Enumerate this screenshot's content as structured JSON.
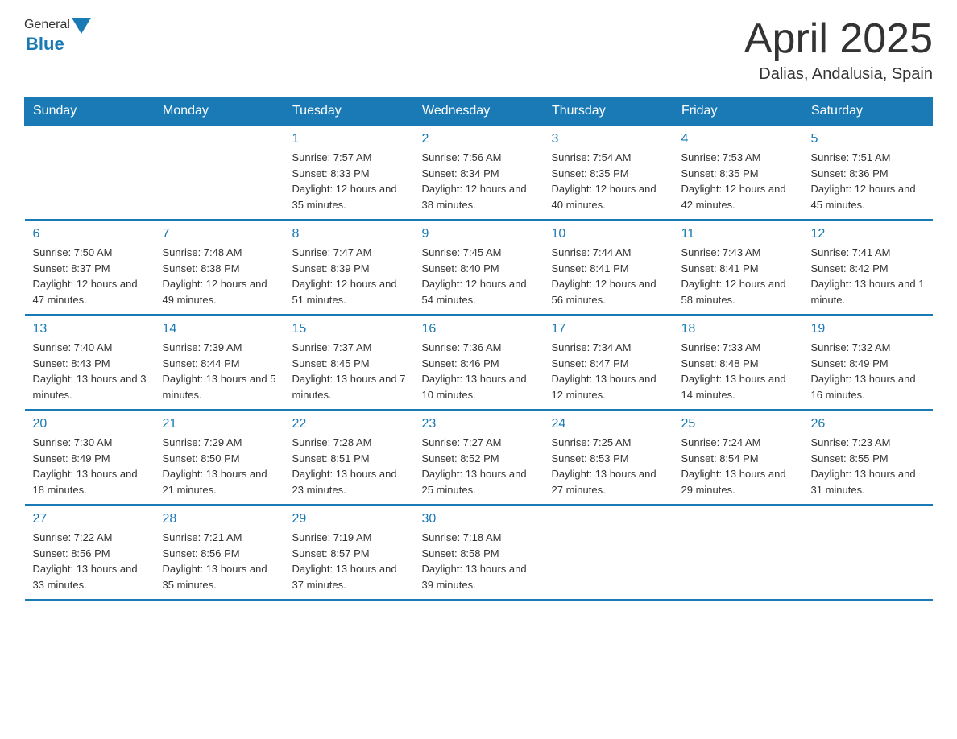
{
  "header": {
    "logo_general": "General",
    "logo_blue": "Blue",
    "month_title": "April 2025",
    "location": "Dalias, Andalusia, Spain"
  },
  "weekdays": [
    "Sunday",
    "Monday",
    "Tuesday",
    "Wednesday",
    "Thursday",
    "Friday",
    "Saturday"
  ],
  "weeks": [
    [
      {
        "day": "",
        "sunrise": "",
        "sunset": "",
        "daylight": ""
      },
      {
        "day": "",
        "sunrise": "",
        "sunset": "",
        "daylight": ""
      },
      {
        "day": "1",
        "sunrise": "Sunrise: 7:57 AM",
        "sunset": "Sunset: 8:33 PM",
        "daylight": "Daylight: 12 hours and 35 minutes."
      },
      {
        "day": "2",
        "sunrise": "Sunrise: 7:56 AM",
        "sunset": "Sunset: 8:34 PM",
        "daylight": "Daylight: 12 hours and 38 minutes."
      },
      {
        "day": "3",
        "sunrise": "Sunrise: 7:54 AM",
        "sunset": "Sunset: 8:35 PM",
        "daylight": "Daylight: 12 hours and 40 minutes."
      },
      {
        "day": "4",
        "sunrise": "Sunrise: 7:53 AM",
        "sunset": "Sunset: 8:35 PM",
        "daylight": "Daylight: 12 hours and 42 minutes."
      },
      {
        "day": "5",
        "sunrise": "Sunrise: 7:51 AM",
        "sunset": "Sunset: 8:36 PM",
        "daylight": "Daylight: 12 hours and 45 minutes."
      }
    ],
    [
      {
        "day": "6",
        "sunrise": "Sunrise: 7:50 AM",
        "sunset": "Sunset: 8:37 PM",
        "daylight": "Daylight: 12 hours and 47 minutes."
      },
      {
        "day": "7",
        "sunrise": "Sunrise: 7:48 AM",
        "sunset": "Sunset: 8:38 PM",
        "daylight": "Daylight: 12 hours and 49 minutes."
      },
      {
        "day": "8",
        "sunrise": "Sunrise: 7:47 AM",
        "sunset": "Sunset: 8:39 PM",
        "daylight": "Daylight: 12 hours and 51 minutes."
      },
      {
        "day": "9",
        "sunrise": "Sunrise: 7:45 AM",
        "sunset": "Sunset: 8:40 PM",
        "daylight": "Daylight: 12 hours and 54 minutes."
      },
      {
        "day": "10",
        "sunrise": "Sunrise: 7:44 AM",
        "sunset": "Sunset: 8:41 PM",
        "daylight": "Daylight: 12 hours and 56 minutes."
      },
      {
        "day": "11",
        "sunrise": "Sunrise: 7:43 AM",
        "sunset": "Sunset: 8:41 PM",
        "daylight": "Daylight: 12 hours and 58 minutes."
      },
      {
        "day": "12",
        "sunrise": "Sunrise: 7:41 AM",
        "sunset": "Sunset: 8:42 PM",
        "daylight": "Daylight: 13 hours and 1 minute."
      }
    ],
    [
      {
        "day": "13",
        "sunrise": "Sunrise: 7:40 AM",
        "sunset": "Sunset: 8:43 PM",
        "daylight": "Daylight: 13 hours and 3 minutes."
      },
      {
        "day": "14",
        "sunrise": "Sunrise: 7:39 AM",
        "sunset": "Sunset: 8:44 PM",
        "daylight": "Daylight: 13 hours and 5 minutes."
      },
      {
        "day": "15",
        "sunrise": "Sunrise: 7:37 AM",
        "sunset": "Sunset: 8:45 PM",
        "daylight": "Daylight: 13 hours and 7 minutes."
      },
      {
        "day": "16",
        "sunrise": "Sunrise: 7:36 AM",
        "sunset": "Sunset: 8:46 PM",
        "daylight": "Daylight: 13 hours and 10 minutes."
      },
      {
        "day": "17",
        "sunrise": "Sunrise: 7:34 AM",
        "sunset": "Sunset: 8:47 PM",
        "daylight": "Daylight: 13 hours and 12 minutes."
      },
      {
        "day": "18",
        "sunrise": "Sunrise: 7:33 AM",
        "sunset": "Sunset: 8:48 PM",
        "daylight": "Daylight: 13 hours and 14 minutes."
      },
      {
        "day": "19",
        "sunrise": "Sunrise: 7:32 AM",
        "sunset": "Sunset: 8:49 PM",
        "daylight": "Daylight: 13 hours and 16 minutes."
      }
    ],
    [
      {
        "day": "20",
        "sunrise": "Sunrise: 7:30 AM",
        "sunset": "Sunset: 8:49 PM",
        "daylight": "Daylight: 13 hours and 18 minutes."
      },
      {
        "day": "21",
        "sunrise": "Sunrise: 7:29 AM",
        "sunset": "Sunset: 8:50 PM",
        "daylight": "Daylight: 13 hours and 21 minutes."
      },
      {
        "day": "22",
        "sunrise": "Sunrise: 7:28 AM",
        "sunset": "Sunset: 8:51 PM",
        "daylight": "Daylight: 13 hours and 23 minutes."
      },
      {
        "day": "23",
        "sunrise": "Sunrise: 7:27 AM",
        "sunset": "Sunset: 8:52 PM",
        "daylight": "Daylight: 13 hours and 25 minutes."
      },
      {
        "day": "24",
        "sunrise": "Sunrise: 7:25 AM",
        "sunset": "Sunset: 8:53 PM",
        "daylight": "Daylight: 13 hours and 27 minutes."
      },
      {
        "day": "25",
        "sunrise": "Sunrise: 7:24 AM",
        "sunset": "Sunset: 8:54 PM",
        "daylight": "Daylight: 13 hours and 29 minutes."
      },
      {
        "day": "26",
        "sunrise": "Sunrise: 7:23 AM",
        "sunset": "Sunset: 8:55 PM",
        "daylight": "Daylight: 13 hours and 31 minutes."
      }
    ],
    [
      {
        "day": "27",
        "sunrise": "Sunrise: 7:22 AM",
        "sunset": "Sunset: 8:56 PM",
        "daylight": "Daylight: 13 hours and 33 minutes."
      },
      {
        "day": "28",
        "sunrise": "Sunrise: 7:21 AM",
        "sunset": "Sunset: 8:56 PM",
        "daylight": "Daylight: 13 hours and 35 minutes."
      },
      {
        "day": "29",
        "sunrise": "Sunrise: 7:19 AM",
        "sunset": "Sunset: 8:57 PM",
        "daylight": "Daylight: 13 hours and 37 minutes."
      },
      {
        "day": "30",
        "sunrise": "Sunrise: 7:18 AM",
        "sunset": "Sunset: 8:58 PM",
        "daylight": "Daylight: 13 hours and 39 minutes."
      },
      {
        "day": "",
        "sunrise": "",
        "sunset": "",
        "daylight": ""
      },
      {
        "day": "",
        "sunrise": "",
        "sunset": "",
        "daylight": ""
      },
      {
        "day": "",
        "sunrise": "",
        "sunset": "",
        "daylight": ""
      }
    ]
  ]
}
